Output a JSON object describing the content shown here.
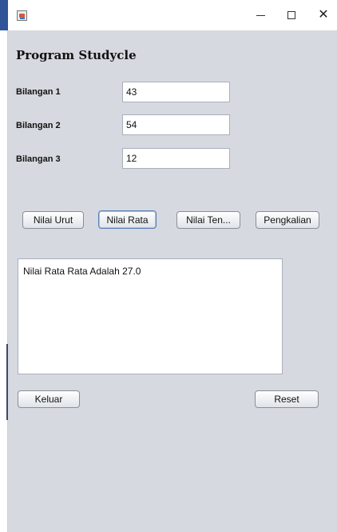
{
  "window": {
    "controls": {
      "minimize": "–",
      "maximize": "☐",
      "close": "✕"
    }
  },
  "form": {
    "heading": "Program Studycle",
    "fields": [
      {
        "label": "Bilangan 1",
        "value": "43"
      },
      {
        "label": "Bilangan 2",
        "value": "54"
      },
      {
        "label": "Bilangan 3",
        "value": "12"
      }
    ]
  },
  "actions": {
    "nilai_urut": "Nilai Urut",
    "nilai_rata": "Nilai Rata",
    "nilai_tengah": "Nilai Ten...",
    "pengkalian": "Pengkalian",
    "keluar": "Keluar",
    "reset": "Reset"
  },
  "output": {
    "text": "Nilai Rata Rata Adalah 27.0"
  }
}
